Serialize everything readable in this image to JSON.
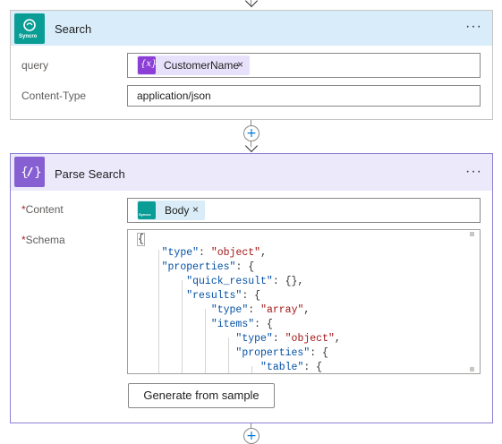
{
  "search_action": {
    "icon": "syncro-icon",
    "icon_text": "Syncro",
    "title": "Search",
    "more": "···",
    "query_label": "query",
    "query_token": {
      "icon": "expression-icon",
      "icon_text": "{x}",
      "text": "CustomerName",
      "remove": "×"
    },
    "content_type_label": "Content-Type",
    "content_type_value": "application/json"
  },
  "parse_action": {
    "icon": "parse-json-icon",
    "icon_text": "{⁄}",
    "title": "Parse Search",
    "more": "···",
    "required_mark": "*",
    "content_label": "Content",
    "content_token": {
      "icon": "syncro-icon",
      "icon_text": "Syncro",
      "text": "Body",
      "remove": "×"
    },
    "schema_label": "Schema",
    "schema_lines": [
      "{",
      "    \"type\": \"object\",",
      "    \"properties\": {",
      "        \"quick_result\": {},",
      "        \"results\": {",
      "            \"type\": \"array\",",
      "            \"items\": {",
      "                \"type\": \"object\",",
      "                \"properties\": {",
      "                    \"table\": {"
    ],
    "generate_button": "Generate from sample"
  },
  "connector": {
    "add_icon": "plus-icon",
    "add_glyph": "+"
  },
  "colors": {
    "syncro": "#0a9d95",
    "parse": "#8660d3",
    "search_header": "#d8ecfa",
    "parse_header": "#ece9fb",
    "accent": "#0078d4"
  }
}
